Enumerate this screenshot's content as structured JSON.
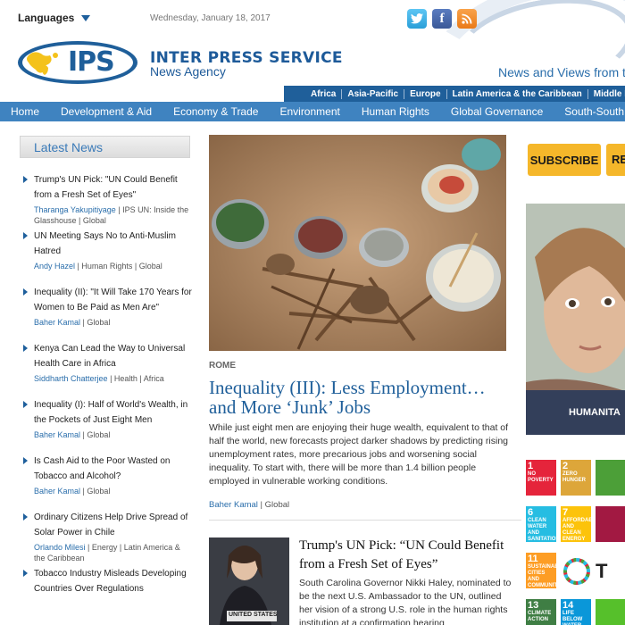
{
  "top": {
    "language_label": "Languages",
    "date": "Wednesday, January 18, 2017"
  },
  "brand": {
    "logo_text": "IPS",
    "title": "INTER PRESS SERVICE",
    "subtitle": "News Agency",
    "tagline": "News and Views from the"
  },
  "region_nav": [
    "Africa",
    "Asia-Pacific",
    "Europe",
    "Latin America & the Caribbean",
    "Middle East & N"
  ],
  "main_nav": [
    "Home",
    "Development & Aid",
    "Economy & Trade",
    "Environment",
    "Human Rights",
    "Global Governance",
    "South-South"
  ],
  "latest": {
    "heading": "Latest News",
    "items": [
      {
        "title": "Trump's UN Pick: \"UN Could Benefit from a Fresh Set of Eyes\"",
        "author": "Tharanga Yakupitiyage",
        "meta": " | IPS UN: Inside the Glasshouse | Global"
      },
      {
        "title": "UN Meeting Says No to Anti-Muslim Hatred",
        "author": "Andy Hazel",
        "meta": " | Human Rights | Global"
      },
      {
        "title": "Inequality (II): \"It Will Take 170 Years for Women to Be Paid as Men Are\"",
        "author": "Baher Kamal",
        "meta": " | Global"
      },
      {
        "title": "Kenya Can Lead the Way to Universal Health Care in Africa",
        "author": "Siddharth Chatterjee",
        "meta": " | Health | Africa"
      },
      {
        "title": "Inequality (I): Half of World's Wealth, in the Pockets of Just Eight Men",
        "author": "Baher Kamal",
        "meta": " | Global"
      },
      {
        "title": "Is Cash Aid to the Poor Wasted on Tobacco and Alcohol?",
        "author": "Baher Kamal",
        "meta": " | Global"
      },
      {
        "title": "Ordinary Citizens Help Drive Spread of Solar Power in Chile",
        "author": "Orlando Milesi",
        "meta": " | Energy | Latin America & the Caribbean"
      },
      {
        "title": "Tobacco Industry Misleads Developing Countries Over Regulations",
        "author": "",
        "meta": ""
      }
    ]
  },
  "feature": {
    "location": "ROME",
    "headline": "Inequality (III): Less Employment… and More ‘Junk’ Jobs",
    "summary": "While just eight men are enjoying their huge wealth, equivalent to that of half the world, new forecasts project darker shadows by predicting rising unemployment rates, more precarious jobs and worsening social inequality. To start with, there will be more than 1.4 billion people employed in vulnerable working conditions.",
    "author": "Baher Kamal",
    "meta": " | Global"
  },
  "second": {
    "title": "Trump's UN Pick: “UN Could Benefit from a Fresh Set of Eyes”",
    "summary": "South Carolina Governor Nikki Haley, nominated to be the next U.S. Ambassador to the UN, outlined her vision of a strong U.S. role in the human rights institution at a confirmation hearing",
    "image_caption": "UNITED STATES"
  },
  "right": {
    "subscribe_label": "SUBSCRIBE",
    "subscribe2_label": "RE",
    "ad_label": "HUMANITA",
    "sdg_tiles": [
      {
        "num": "1",
        "text": "NO POVERTY",
        "color": "#e5243b"
      },
      {
        "num": "2",
        "text": "ZERO HUNGER",
        "color": "#dda63a"
      },
      {
        "num": "6",
        "text": "CLEAN WATER AND SANITATION",
        "color": "#26bde2"
      },
      {
        "num": "7",
        "text": "AFFORDABLE AND CLEAN ENERGY",
        "color": "#fcc30b"
      },
      {
        "num": "11",
        "text": "SUSTAINABLE CITIES AND COMMUNITIES",
        "color": "#fd9d24"
      },
      {
        "num": "13",
        "text": "CLIMATE ACTION",
        "color": "#3f7e44"
      },
      {
        "num": "14",
        "text": "LIFE BELOW WATER",
        "color": "#0a97d9"
      }
    ]
  }
}
